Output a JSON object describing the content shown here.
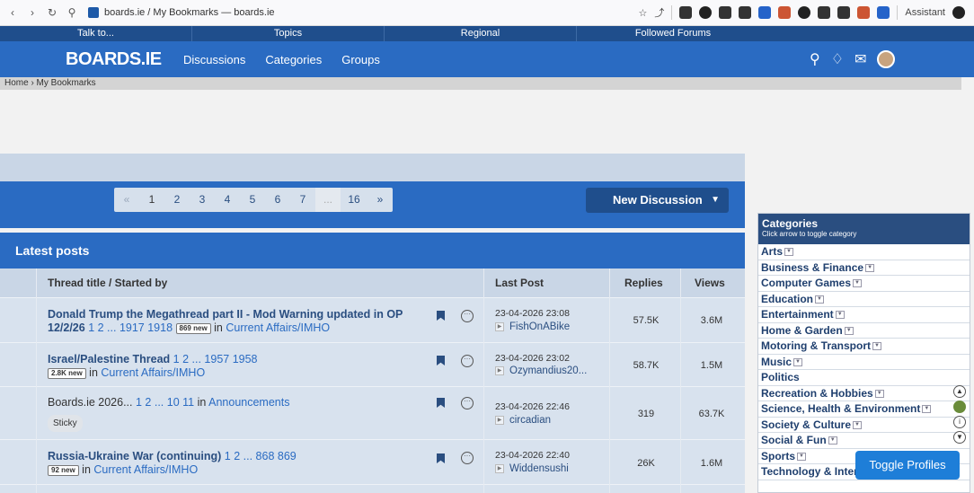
{
  "browser": {
    "url": "boards.ie / My Bookmarks — boards.ie",
    "assistant_label": "Assistant",
    "badge_count": "6"
  },
  "top_strip": [
    "Talk to...",
    "Topics",
    "Regional",
    "Followed Forums"
  ],
  "header": {
    "logo": "BOARDS.IE",
    "nav": [
      "Discussions",
      "Categories",
      "Groups"
    ]
  },
  "breadcrumb": "Home › My Bookmarks",
  "pager": {
    "prev": "«",
    "pages": [
      "1",
      "2",
      "3",
      "4",
      "5",
      "6",
      "7"
    ],
    "dots": "...",
    "last": "16",
    "next": "»",
    "current": "1"
  },
  "new_discussion": "New Discussion",
  "latest_posts": "Latest posts",
  "table": {
    "col_title": "Thread title / Started by",
    "col_last": "Last Post",
    "col_replies": "Replies",
    "col_views": "Views"
  },
  "threads": [
    {
      "title": "Donald Trump the Megathread part II - Mod Warning updated in OP 12/2/26",
      "pages": "1 2 ... 1917 1918",
      "new": "869 new",
      "in": "in",
      "forum": "Current Affairs/IMHO",
      "date": "23-04-2026 23:08",
      "user": "FishOnABike",
      "replies": "57.5K",
      "views": "3.6M"
    },
    {
      "title": "Israel/Palestine Thread",
      "pages": "1 2 ... 1957 1958",
      "new": "2.8K new",
      "in": "in",
      "forum": "Current Affairs/IMHO",
      "date": "23-04-2026 23:02",
      "user": "Ozymandius20...",
      "replies": "58.7K",
      "views": "1.5M"
    },
    {
      "title": "Boards.ie 2026...",
      "pages": "1 2 ... 10 11",
      "in": "in",
      "forum": "Announcements",
      "sticky": "Sticky",
      "date": "23-04-2026 22:46",
      "user": "circadian",
      "replies": "319",
      "views": "63.7K"
    },
    {
      "title": "Russia-Ukraine War (continuing)",
      "pages": "1 2 ... 868 869",
      "new": "92 new",
      "in": "in",
      "forum": "Current Affairs/IMHO",
      "date": "23-04-2026 22:40",
      "user": "Widdensushi",
      "replies": "26K",
      "views": "1.6M"
    }
  ],
  "categories": {
    "title": "Categories",
    "subtitle": "Click arrow to toggle category",
    "items": [
      "Arts",
      "Business & Finance",
      "Computer Games",
      "Education",
      "Entertainment",
      "Home & Garden",
      "Motoring & Transport",
      "Music",
      "Politics",
      "Recreation & Hobbies",
      "Science, Health & Environment",
      "Society & Culture",
      "Social & Fun",
      "Sports",
      "Technology & Internet"
    ]
  },
  "toggle_profiles": "Toggle Profiles",
  "colors": {
    "primary": "#2a6bc2",
    "dark": "#1f4e8c",
    "row_bg": "#d8e2ee"
  }
}
